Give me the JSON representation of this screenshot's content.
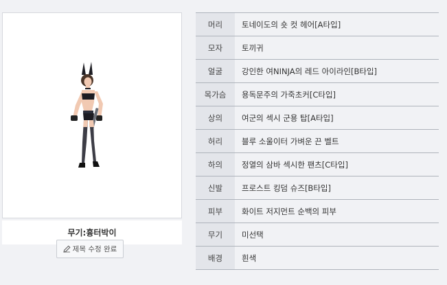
{
  "character": {
    "weapon_caption": "무기:흉터박이",
    "edit_title_label": "제목 수정 완료"
  },
  "equipment": [
    {
      "slot": "머리",
      "item": "토네이도의 숏 컷 헤어[A타입]"
    },
    {
      "slot": "모자",
      "item": "토끼귀"
    },
    {
      "slot": "얼굴",
      "item": "강인한 여NINJA의 레드 아이라인[B타입]"
    },
    {
      "slot": "목가슴",
      "item": "용독문주의 가죽초커[C타입]"
    },
    {
      "slot": "상의",
      "item": "여군의 섹시 군용 탑[A타입]"
    },
    {
      "slot": "허리",
      "item": "블루 소울이터 가벼운 끈 벨트"
    },
    {
      "slot": "하의",
      "item": "정열의 삼바 섹시한 팬츠[C타입]"
    },
    {
      "slot": "신발",
      "item": "프로스트 킹덤 슈즈[B타입]"
    },
    {
      "slot": "피부",
      "item": "화이트 저지먼트 순백의 피부"
    },
    {
      "slot": "무기",
      "item": "미선택"
    },
    {
      "slot": "배경",
      "item": "흰색"
    }
  ],
  "icons": {
    "edit": "pencil-icon"
  }
}
